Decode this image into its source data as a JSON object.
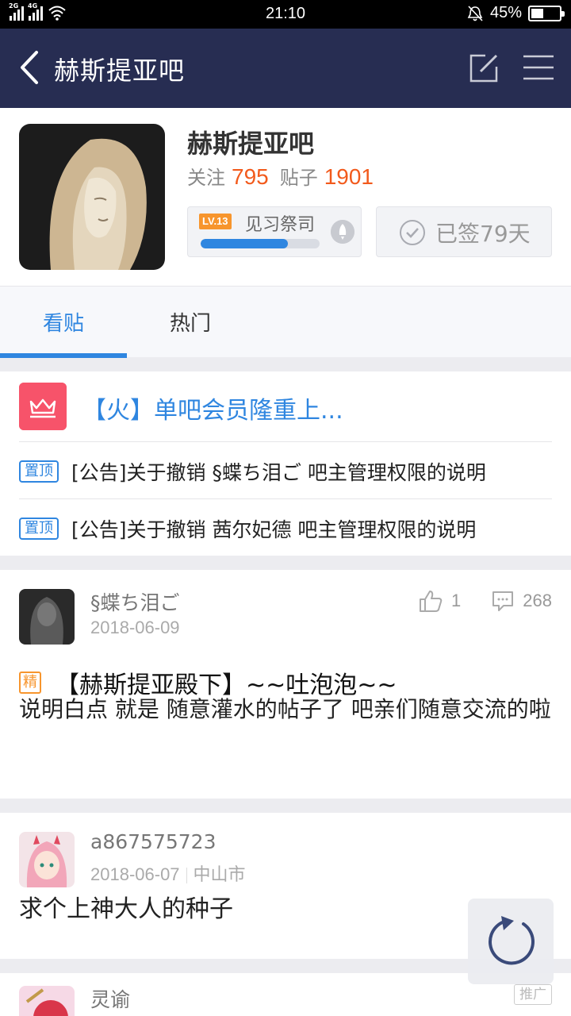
{
  "status_bar": {
    "time": "21:10",
    "battery": "45%",
    "battery_level": 0.45,
    "network_1": "2G",
    "network_2": "4G"
  },
  "nav": {
    "title": "赫斯提亚吧"
  },
  "forum": {
    "name": "赫斯提亚吧",
    "follow_label": "关注",
    "follow_count": "795",
    "posts_label": "贴子",
    "posts_count": "1901",
    "level_badge": "LV.13",
    "level_name": "见习祭司",
    "level_progress": 0.73,
    "sign_label": "已签79天"
  },
  "tabs": [
    {
      "label": "看贴"
    },
    {
      "label": "热门"
    }
  ],
  "announcements": {
    "member_text": "【火】单吧会员隆重上...",
    "pinned": [
      {
        "badge": "置顶",
        "text": "[公告]关于撤销 §蝶ち泪ご 吧主管理权限的说明"
      },
      {
        "badge": "置顶",
        "text": "[公告]关于撤销 茜尔妃德 吧主管理权限的说明"
      }
    ]
  },
  "posts": [
    {
      "username": "§蝶ち泪ご",
      "date": "2018-06-09",
      "likes": "1",
      "comments": "268",
      "badge": "精",
      "title": "【赫斯提亚殿下】~~吐泡泡~~",
      "body": "说明白点 就是 随意灌水的帖子了 吧亲们随意交流的啦"
    },
    {
      "username": "a867575723",
      "date": "2018-06-07",
      "location": "中山市",
      "body": "求个上神大人的种子"
    },
    {
      "username": "灵谕",
      "ad_label": "推广"
    }
  ],
  "colors": {
    "nav_bg": "#272d52",
    "accent_blue": "#2f86e0",
    "count_orange": "#f25a1c",
    "crown_red": "#f7536a"
  }
}
